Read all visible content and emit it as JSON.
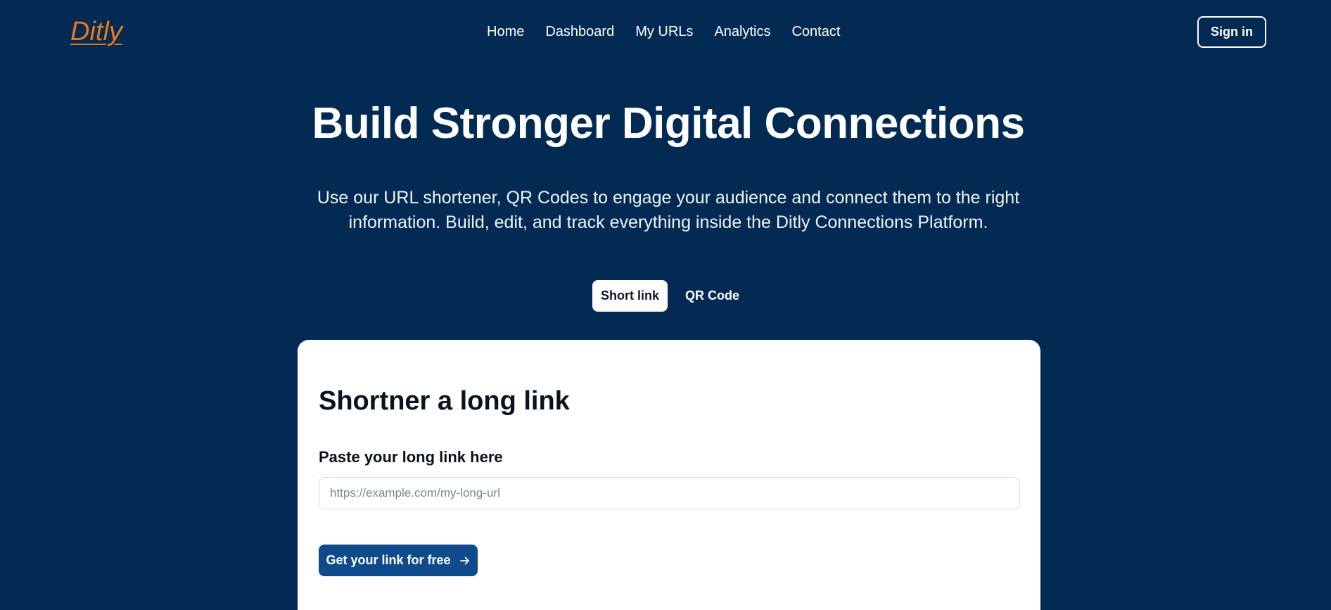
{
  "header": {
    "logo": "Ditly",
    "nav": [
      "Home",
      "Dashboard",
      "My URLs",
      "Analytics",
      "Contact"
    ],
    "signin_label": "Sign in"
  },
  "hero": {
    "title": "Build Stronger Digital Connections",
    "subtitle": "Use our URL shortener, QR Codes to engage your audience and connect them to the right information. Build, edit, and track everything inside the Ditly Connections Platform."
  },
  "tabs": {
    "short_link": "Short link",
    "qr_code": "QR Code",
    "active": "short_link"
  },
  "form": {
    "title": "Shortner a long link",
    "label": "Paste your long link here",
    "placeholder": "https://example.com/my-long-url",
    "value": "",
    "submit_label": "Get your link for free",
    "submit_icon": "arrow-right-icon"
  },
  "colors": {
    "background": "#022a52",
    "logo": "#ee7622",
    "button": "#0f4a8a",
    "card": "#ffffff"
  }
}
